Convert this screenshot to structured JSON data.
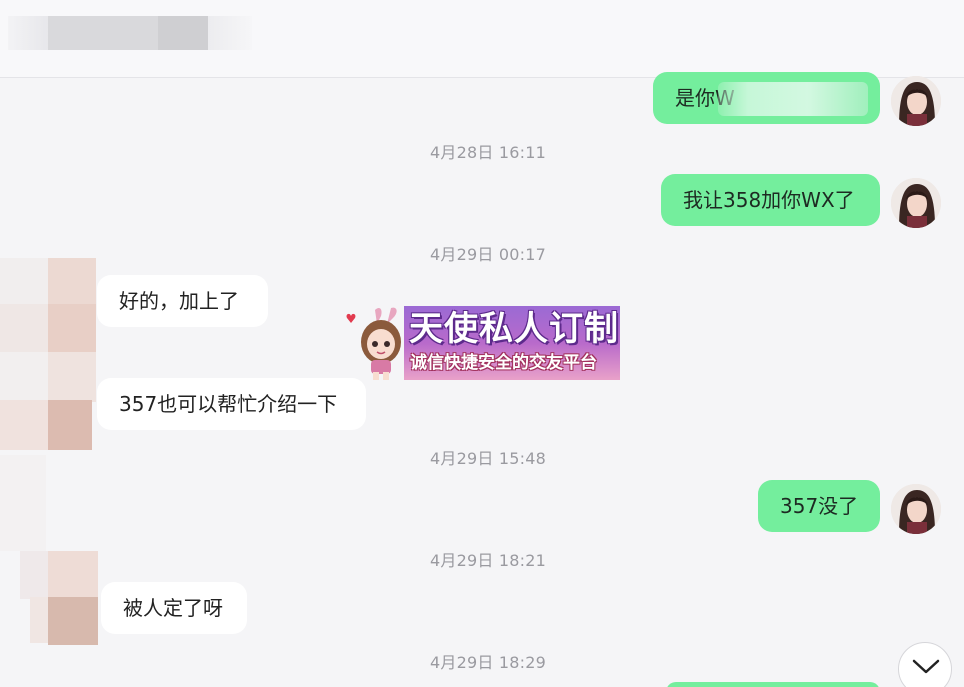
{
  "messages": [
    {
      "side": "mine",
      "text": "是你W",
      "time": null
    },
    {
      "time": "4月28日 16:11"
    },
    {
      "side": "mine",
      "text": "我让358加你WX了"
    },
    {
      "time": "4月29日 00:17"
    },
    {
      "side": "theirs",
      "text": "好的，加上了"
    },
    {
      "side": "theirs",
      "text": "357也可以帮忙介绍一下"
    },
    {
      "time": "4月29日 15:48"
    },
    {
      "side": "mine",
      "text": "357没了"
    },
    {
      "time": "4月29日 18:21"
    },
    {
      "side": "theirs",
      "text": "被人定了呀"
    },
    {
      "time": "4月29日 18:29"
    }
  ],
  "chat": {
    "msg1": "是你W",
    "time1": "4月28日 16:11",
    "msg2": "我让358加你WX了",
    "time2": "4月29日 00:17",
    "msg3": "好的，加上了",
    "msg4": "357也可以帮忙介绍一下",
    "time3": "4月29日 15:48",
    "msg5": "357没了",
    "time4": "4月29日 18:21",
    "msg6": "被人定了呀",
    "time5": "4月29日 18:29"
  },
  "promo": {
    "title": "天使私人订制",
    "subtitle": "诚信快捷安全的交友平台"
  },
  "colors": {
    "my_bubble": "#74ee9d",
    "their_bubble": "#ffffff",
    "background": "#f5f5f7",
    "timestamp": "#9a9aa0"
  },
  "icons": {
    "scroll_down": "chevron-down-icon",
    "promo_mascot": "bunny-girl-mascot-icon"
  }
}
